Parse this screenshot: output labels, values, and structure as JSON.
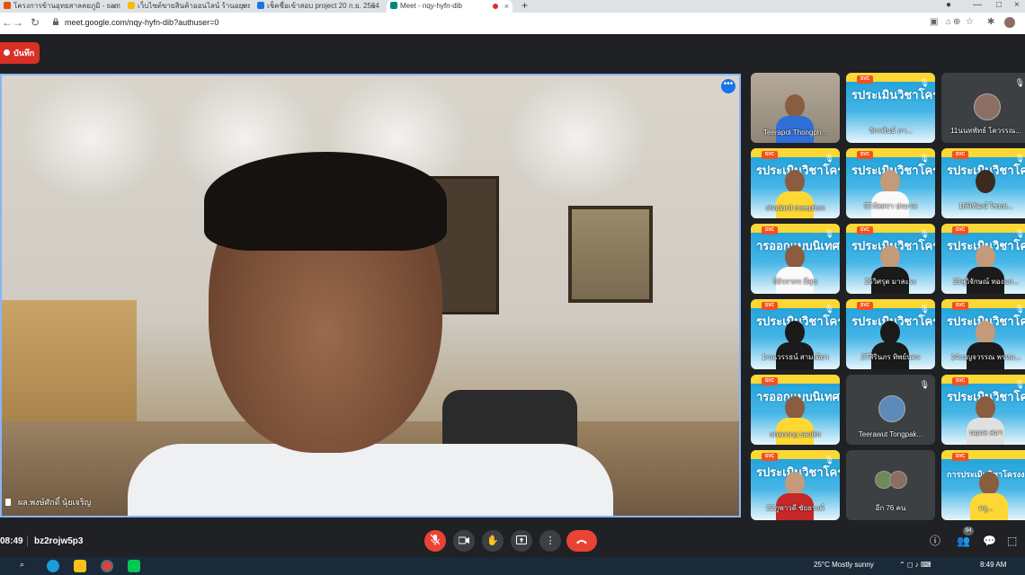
{
  "browser": {
    "tabs": [
      {
        "label": "โครงการข้านอุทยสาลคยภูมิ - samrit",
        "color": "#e65100"
      },
      {
        "label": "เว็บไซต์ขายสินค้าออนไลน์ ร้านอยุทยสาม",
        "color": "#fbbc04"
      },
      {
        "label": "เช็คชื่อเข้าสอบ project 20 ก.ย. 2564",
        "color": "#1a73e8"
      },
      {
        "label": "Meet - nqy-hyfn-dib",
        "color": "#00897b"
      }
    ],
    "new_tab": "+",
    "url": "meet.google.com/nqy-hyfn-dib?authuser=0"
  },
  "meeting": {
    "recording_label": "บันทึก",
    "main_speaker_name": "ผล.พงษ์ศักดิ์ นุ้ยเจริญ",
    "clock": "08:49",
    "code": "bz2rojw5p3",
    "participant_count": "94",
    "tiles": [
      {
        "name": "Teerapol Thongph...",
        "kind": "photo",
        "muted": false
      },
      {
        "name": "จักรพันธ์ ภา...",
        "kind": "slide",
        "slide_text": "รประเมินวิชาโครงงา",
        "muted": true
      },
      {
        "name": "11นนทพัทธ์ โตวรรณ...",
        "kind": "avatar",
        "muted": true
      },
      {
        "name": "chadanit meephon",
        "kind": "slide",
        "slide_text": "รประเมินวิชาโครงงา",
        "muted": true
      },
      {
        "name": "57ภัสสรา ปรมาล",
        "kind": "slide",
        "slide_text": "รประเมินวิชาโครงงา",
        "muted": true
      },
      {
        "name": "16พิพัฒน์ ไชยพ...",
        "kind": "slide",
        "slide_text": "รประเมินวิชาโครงงา",
        "muted": true
      },
      {
        "name": "50วรากร มีสุข",
        "kind": "slide",
        "slide_text": "ารออกแบบนิเทศน์",
        "muted": true
      },
      {
        "name": "25วิศรุต มาละระ",
        "kind": "slide",
        "slide_text": "รประเมินวิชาโครงงา",
        "muted": true
      },
      {
        "name": "29สุวิจักษณ์ ทองแก...",
        "kind": "slide",
        "slide_text": "รประเมินวิชาโครงงา",
        "muted": true
      },
      {
        "name": "1กณวรรธน์ สามเดียว",
        "kind": "slide",
        "slide_text": "รประเมินวิชาโครงงา",
        "muted": true
      },
      {
        "name": "27สิรินภร ทิพย์นคร",
        "kind": "slide",
        "slide_text": "รประเมินวิชาโครงงา",
        "muted": true
      },
      {
        "name": "14เบญจวรรณ พรหม...",
        "kind": "slide",
        "slide_text": "รประเมินวิชาโครงงา",
        "muted": true
      },
      {
        "name": "onanong saolim",
        "kind": "slide",
        "slide_text": "ารออกแบบนิเทศน์",
        "muted": false
      },
      {
        "name": "Teerawut Tongpak...",
        "kind": "avatar",
        "muted": true
      },
      {
        "name": "นฤมล สมา",
        "kind": "slide",
        "slide_text": "รประเมินวิชาโครงงา",
        "muted": true
      },
      {
        "name": "22ภูพาวดี ชัยธรงค์",
        "kind": "slide",
        "slide_text": "รประเมินวิชาโครงงา",
        "muted": true
      },
      {
        "name": "อีก 76 คน",
        "kind": "more",
        "muted": false
      },
      {
        "name": "ครู...",
        "kind": "slide",
        "slide_text": "การประเมินวิชาโครงงาน",
        "muted": false
      }
    ]
  },
  "taskbar": {
    "time": "8:49 AM",
    "weather": "25°C Mostly sunny"
  }
}
